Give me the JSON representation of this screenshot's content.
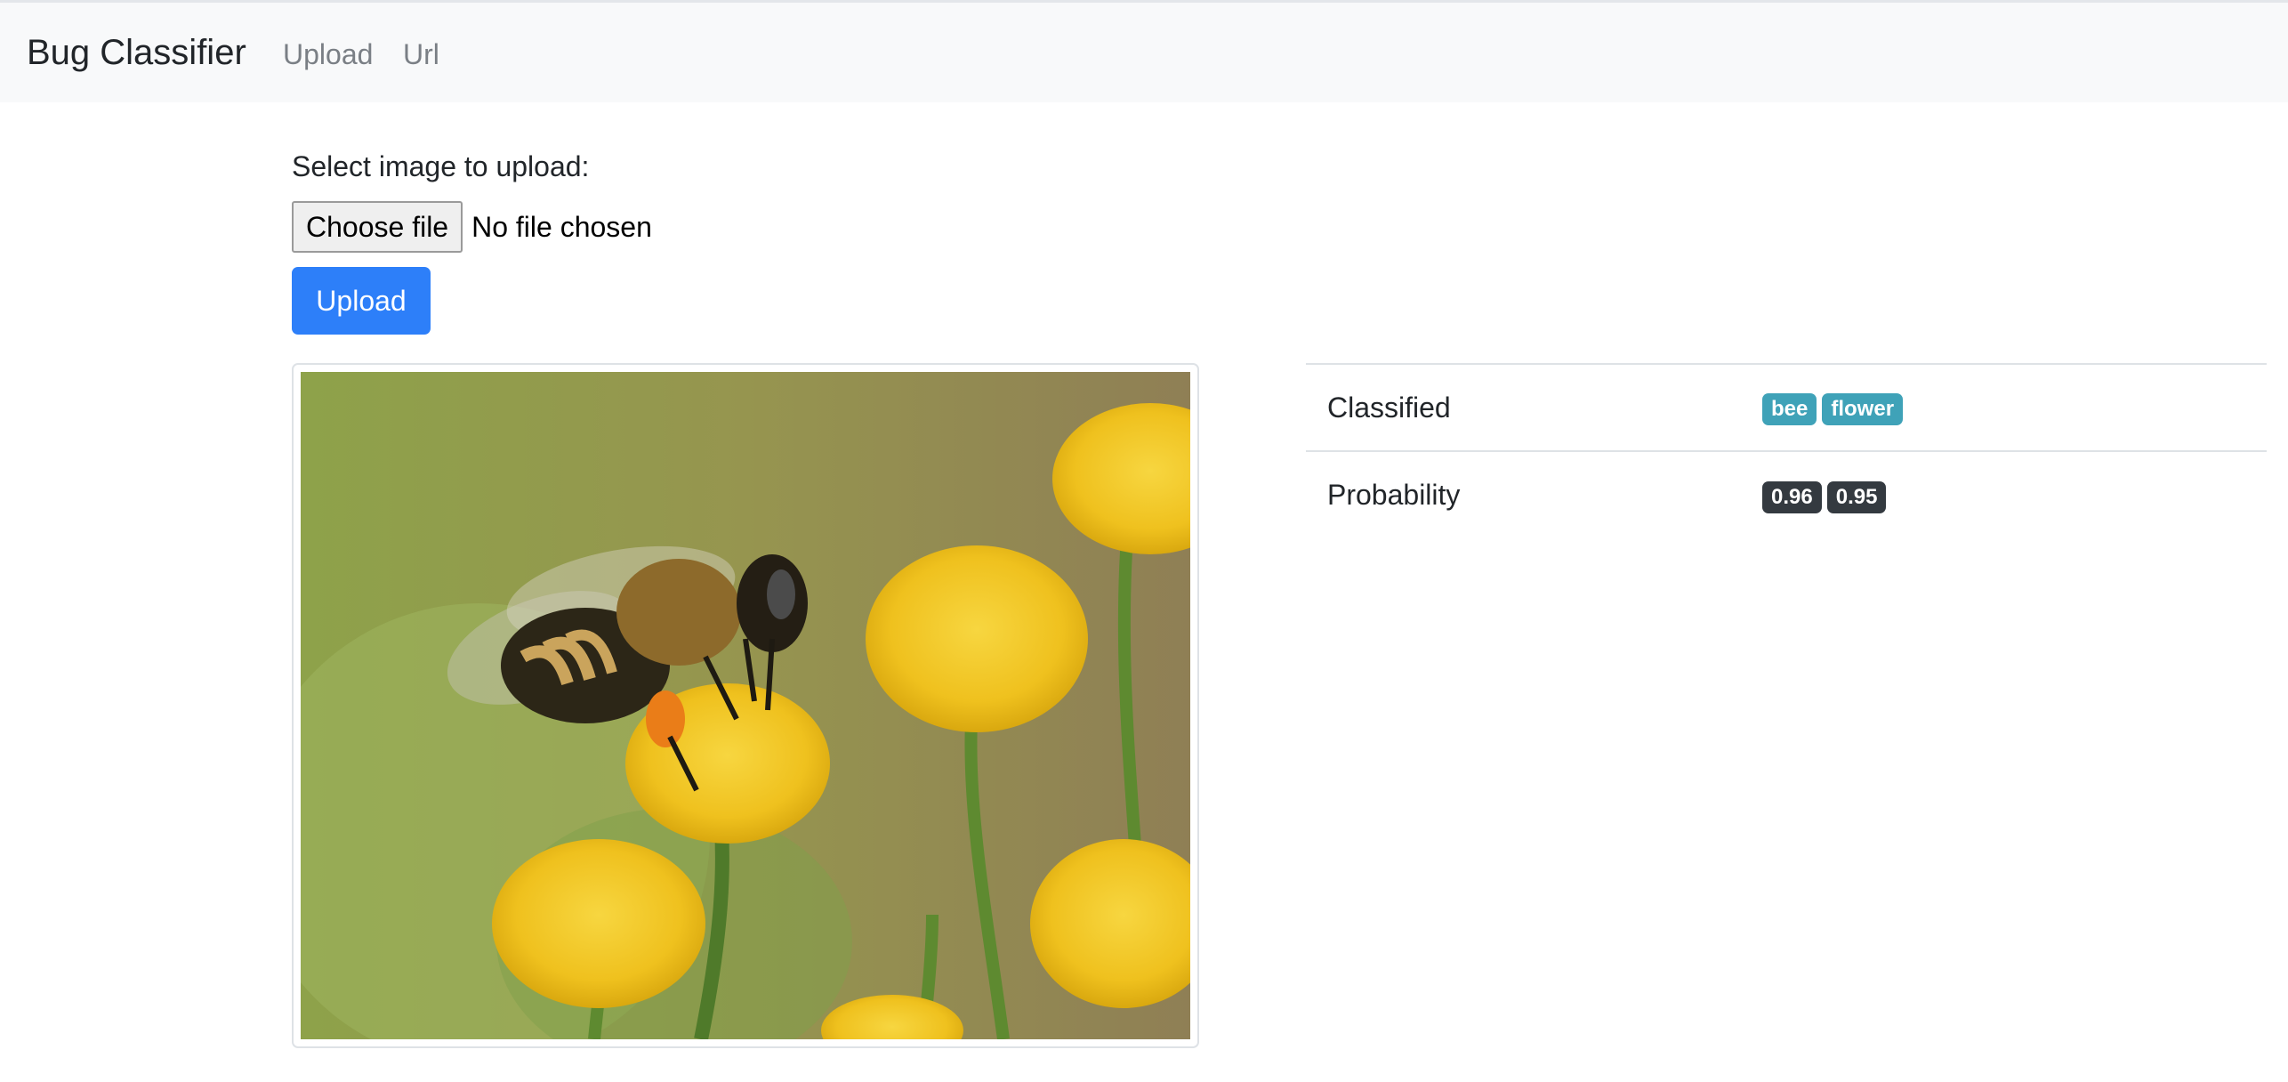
{
  "navbar": {
    "brand": "Bug Classifier",
    "links": [
      "Upload",
      "Url"
    ]
  },
  "form": {
    "label": "Select image to upload:",
    "choose_file_label": "Choose file",
    "no_file_text": "No file chosen",
    "submit_label": "Upload"
  },
  "image": {
    "subject": "honeybee on yellow tansy flowers"
  },
  "results": {
    "rows": [
      {
        "label": "Classified",
        "badges": [
          "bee",
          "flower"
        ]
      },
      {
        "label": "Probability",
        "badges": [
          "0.96",
          "0.95"
        ]
      }
    ]
  },
  "colors": {
    "primary": "#2d7ff9",
    "badge_info": "#3fa2b8",
    "badge_dark": "#343a40",
    "navbar_bg": "#f8f9fa"
  }
}
